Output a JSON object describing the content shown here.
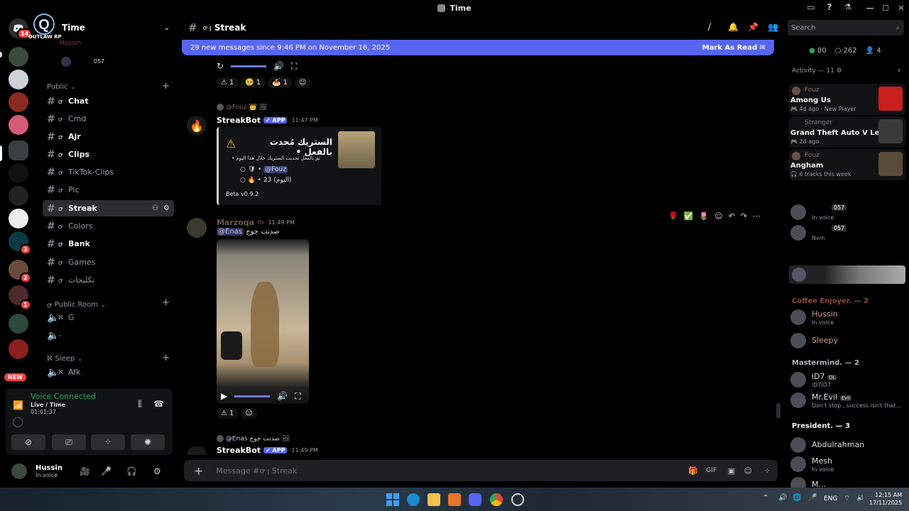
{
  "window": {
    "title": "Time"
  },
  "server": {
    "name": "Time",
    "logo_text": "OUTLAW RP",
    "badge": "14",
    "new_badge": "NEW"
  },
  "rail_badges": [
    "3",
    "2",
    "1"
  ],
  "channel_list": {
    "top_users": [
      "Hussin",
      "057"
    ],
    "categories": [
      {
        "name": "Public"
      },
      {
        "name": "Public Room"
      },
      {
        "name": "Sleep"
      }
    ],
    "channels": [
      {
        "label": "Chat",
        "icon": "hash"
      },
      {
        "label": "Cmd",
        "icon": "hash"
      },
      {
        "label": "Ajr",
        "icon": "hash"
      },
      {
        "label": "Clips",
        "icon": "hash"
      },
      {
        "label": "TikTok-Clips",
        "icon": "hash"
      },
      {
        "label": "Pic",
        "icon": "hash"
      },
      {
        "label": "Streak",
        "icon": "hash"
      },
      {
        "label": "Colors",
        "icon": "hash"
      },
      {
        "label": "Bank",
        "icon": "hash"
      },
      {
        "label": "Games",
        "icon": "hash"
      },
      {
        "label": "تكليجات",
        "icon": "hash"
      }
    ],
    "voice_channels": [
      "G",
      "-",
      "Afk"
    ]
  },
  "voice": {
    "status": "Voice Connected",
    "channel": "Live / Time",
    "timer": "01:01:37"
  },
  "user": {
    "name": "Hussin",
    "status": "In voice"
  },
  "channel_header": {
    "name": "Streak"
  },
  "new_messages": {
    "text": "29 new messages since 9:46 PM on November 16, 2025",
    "action": "Mark As Read"
  },
  "messages": {
    "top_reactions": [
      {
        "emoji": "⚠",
        "count": "1"
      },
      {
        "emoji": "🥺",
        "count": "1"
      },
      {
        "emoji": "🍝",
        "count": "1"
      }
    ],
    "bot1": {
      "reply_to": "@Fouz",
      "author": "StreakBot",
      "tag": "APP",
      "time": "11:47 PM",
      "embed_title": "الستريك مُحدث بالفعل •",
      "embed_line1": "تم بالفعل تحديث الستريك خلال هذا اليوم",
      "embed_mention": "@Fouz",
      "embed_count": "23 (اليوم)",
      "embed_footer": "Beta v0.9.2"
    },
    "msg2": {
      "author": "Marzoqa",
      "time": "11:49 PM",
      "mention": "@Enas",
      "text": "صدنت جوج"
    },
    "msg2_reactions": [
      {
        "emoji": "⚠",
        "count": "1"
      }
    ],
    "bot2": {
      "reply_to": "@Enas",
      "reply_text": "صدنت جوج",
      "author": "StreakBot",
      "tag": "APP",
      "time": "11:49 PM"
    }
  },
  "composer": {
    "placeholder": "Message #ꝍ ꞁ Streak"
  },
  "search": {
    "placeholder": "Search"
  },
  "members": {
    "counts": {
      "online": "80",
      "idle": "262",
      "other": "4"
    },
    "activity_header": "Activity — 11",
    "activities": [
      {
        "user": "Fouz",
        "game": "Among Us",
        "meta": "4d ago",
        "meta2": "New Player"
      },
      {
        "user": "Stranger",
        "game": "Grand Theft Auto V Legacy",
        "meta": "2d ago",
        "meta2": ""
      },
      {
        "user": "Fouz",
        "game": "Angham",
        "meta": "6 tracks this week",
        "meta2": ""
      }
    ],
    "sections": [
      {
        "title": "Coffee Enjoyer. — 2",
        "color": "#8a4a3a"
      },
      {
        "title": "Mastermind. — 2",
        "color": "#b0b3b8"
      },
      {
        "title": "President. — 3",
        "color": "#f2f3f5"
      }
    ],
    "list": [
      {
        "name": "057",
        "sub": "In voice"
      },
      {
        "name": "057",
        "sub": "Nvm"
      },
      {
        "name": "Hussin",
        "sub": "In voice"
      },
      {
        "name": "Sleepy",
        "sub": ""
      },
      {
        "name": "iD7",
        "sub": "iD7iD7",
        "tag": "OL"
      },
      {
        "name": "Mr.Evil",
        "sub": "Don't stop , success isn't that...",
        "tag": "Evil"
      },
      {
        "name": "Abdulrahman",
        "sub": ""
      },
      {
        "name": "Mesh",
        "sub": "In voice"
      },
      {
        "name": "M...",
        "sub": ""
      }
    ]
  },
  "taskbar": {
    "lang": "ENG",
    "time": "12:15 AM",
    "date": "17/11/2025"
  },
  "colors": {
    "accent": "#5865f2",
    "bg": "#000000",
    "panel": "#111214",
    "green": "#23a55a",
    "red": "#f23f43"
  }
}
